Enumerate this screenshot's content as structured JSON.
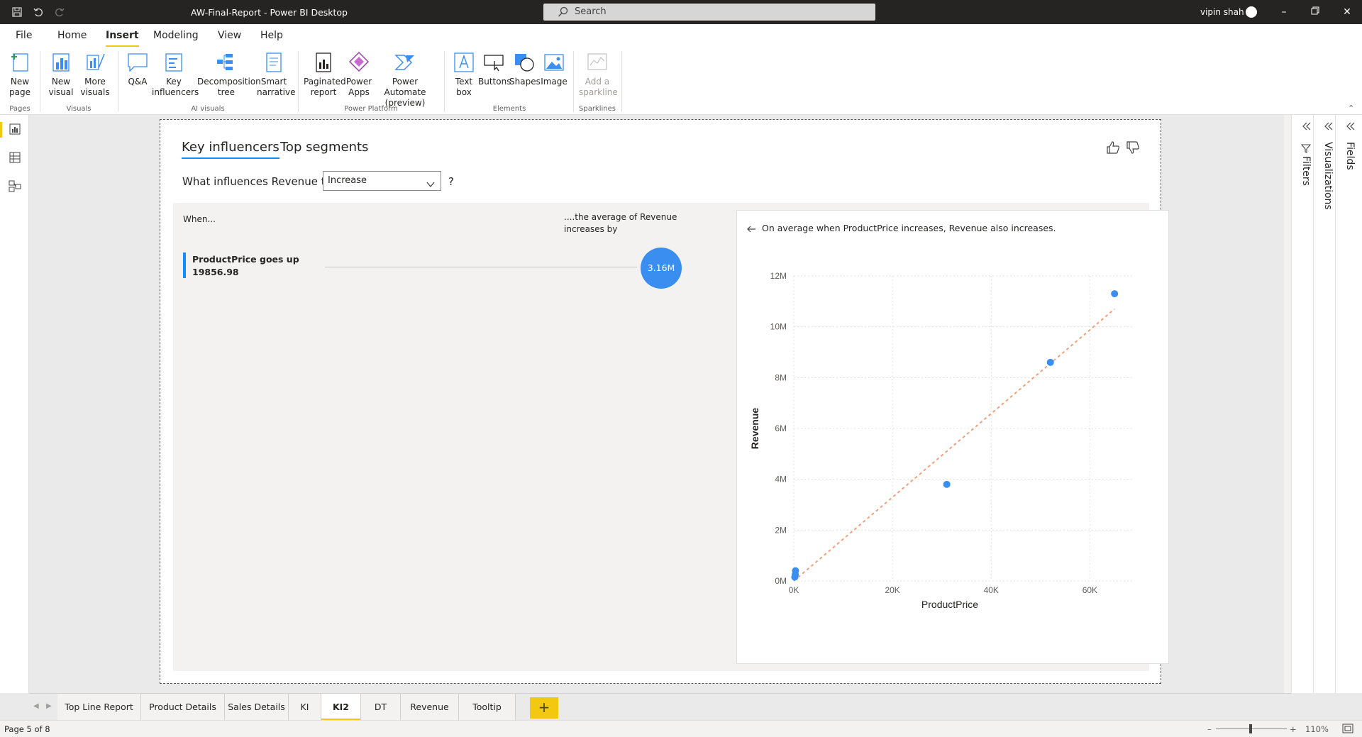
{
  "window": {
    "title": "AW-Final-Report - Power BI Desktop",
    "search_placeholder": "Search",
    "user": "vipin shah"
  },
  "menu": {
    "items": [
      "File",
      "Home",
      "Insert",
      "Modeling",
      "View",
      "Help"
    ],
    "active": "Insert"
  },
  "ribbon": {
    "buttons": {
      "new_page": "New page",
      "new_visual": "New visual",
      "more_visuals": "More visuals",
      "qa": "Q&A",
      "key_influencers": "Key influencers",
      "decomposition_tree": "Decomposition tree",
      "smart_narrative": "Smart narrative",
      "paginated_report": "Paginated report",
      "power_apps": "Power Apps",
      "power_automate": "Power Automate (preview)",
      "text_box": "Text box",
      "buttons": "Buttons",
      "shapes": "Shapes",
      "image": "Image",
      "add_sparkline": "Add a sparkline"
    },
    "groups": {
      "pages": "Pages",
      "visuals": "Visuals",
      "ai_visuals": "AI visuals",
      "power_platform": "Power Platform",
      "elements": "Elements",
      "sparklines": "Sparklines"
    }
  },
  "visual": {
    "tabs": [
      "Key influencers",
      "Top segments"
    ],
    "active_tab": "Key influencers",
    "question_prefix": "What influences Revenue to",
    "dropdown_value": "Increase",
    "question_suffix": "?",
    "when_label": "When...",
    "avg_label": "....the average of Revenue increases by",
    "influencer": {
      "line1": "ProductPrice goes up",
      "line2": "19856.98",
      "value": "3.16M"
    },
    "detail_message": "On average when ProductPrice increases, Revenue also increases."
  },
  "chart_data": {
    "type": "scatter",
    "xlabel": "ProductPrice",
    "ylabel": "Revenue",
    "x_ticks": [
      "0K",
      "20K",
      "40K",
      "60K"
    ],
    "y_ticks": [
      "0M",
      "2M",
      "4M",
      "6M",
      "8M",
      "10M",
      "12M"
    ],
    "xlim": [
      0,
      69000
    ],
    "ylim": [
      0,
      12000000
    ],
    "grid": true,
    "points": [
      {
        "x": 200,
        "y": 150000
      },
      {
        "x": 300,
        "y": 250000
      },
      {
        "x": 350,
        "y": 400000
      },
      {
        "x": 31000,
        "y": 3800000
      },
      {
        "x": 52000,
        "y": 8600000
      },
      {
        "x": 65000,
        "y": 11300000
      }
    ],
    "trendline": {
      "x": [
        0,
        65000
      ],
      "y": [
        0,
        10700000
      ]
    },
    "point_color": "#3a8ef0",
    "trend_color": "#f0a07a"
  },
  "pages": {
    "tabs": [
      "Top Line Report",
      "Product Details",
      "Sales Details",
      "KI",
      "KI2",
      "DT",
      "Revenue",
      "Tooltip"
    ],
    "active": "KI2",
    "add_label": "+"
  },
  "status": {
    "page": "Page 5 of 8",
    "zoom": "110%"
  },
  "panes": {
    "filters": "Filters",
    "visualizations": "Visualizations",
    "fields": "Fields"
  },
  "colors": {
    "accent": "#f2c811",
    "brand_blue": "#118dff"
  }
}
